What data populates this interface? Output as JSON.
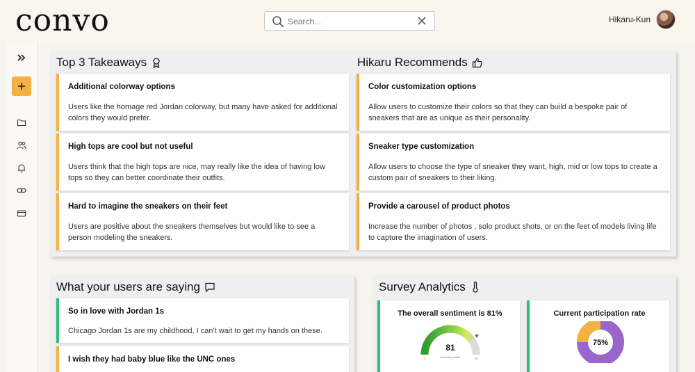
{
  "app": {
    "logo": "convo"
  },
  "search": {
    "placeholder": "Search..."
  },
  "user": {
    "name": "Hikaru-Kun"
  },
  "takeaways": {
    "title": "Top 3 Takeaways",
    "items": [
      {
        "title": "Additional colorway options",
        "body": "Users like the homage red Jordan colorway, but many have asked for additional colors they would prefer."
      },
      {
        "title": "High tops are cool but not useful",
        "body": "Users think that the high tops are nice, may really like the idea of having low tops so they can better coordinate their outfits."
      },
      {
        "title": "Hard to imagine the sneakers on their feet",
        "body": "Users are positive about the sneakers themselves but would like to see a person modeling the sneakers."
      }
    ]
  },
  "recommends": {
    "title": "Hikaru Recommends",
    "items": [
      {
        "title": "Color customization options",
        "body": "Allow users to customize their colors so that they can build a bespoke pair of sneakers that are as unique as their personality."
      },
      {
        "title": "Sneaker type customization",
        "body": "Allow users to choose the type of sneaker they want, high, mid or low tops to create a custom pair of sneakers to their liking."
      },
      {
        "title": "Provide a carousel of product photos",
        "body": "Increase the number of photos , solo product shots, or on the feet of models living life to capture the imagination of users."
      }
    ]
  },
  "saying": {
    "title": "What your users are saying",
    "items": [
      {
        "title": "So in love with Jordan 1s",
        "body": "Chicago Jordan 1s are my childhood, I can't wait to get my hands on these."
      },
      {
        "title": "I wish they had baby blue like the UNC ones",
        "body": ""
      }
    ]
  },
  "analytics": {
    "title": "Survey Analytics",
    "sentiment": {
      "label": "The overall sentiment is 81%",
      "value": "81",
      "percent": 81,
      "min": "0",
      "max": "100",
      "caption": "Extremely positive"
    },
    "participation": {
      "label": "Current participation rate",
      "value": "75%",
      "percent": 75
    }
  },
  "colors": {
    "accent": "#f4b042",
    "green": "#2bbf7e",
    "purple": "#9966cc",
    "orange": "#f4b042"
  },
  "icons": {
    "search": "search-icon",
    "clear": "close-icon",
    "expand": "double-chevron-right-icon",
    "add": "plus-icon",
    "nav": [
      "folder-icon",
      "users-icon",
      "bell-icon",
      "link-icon",
      "card-icon"
    ],
    "takeaways": "award-icon",
    "recommends": "thumbs-up-icon",
    "saying": "chat-icon",
    "analytics": "thermometer-icon"
  }
}
